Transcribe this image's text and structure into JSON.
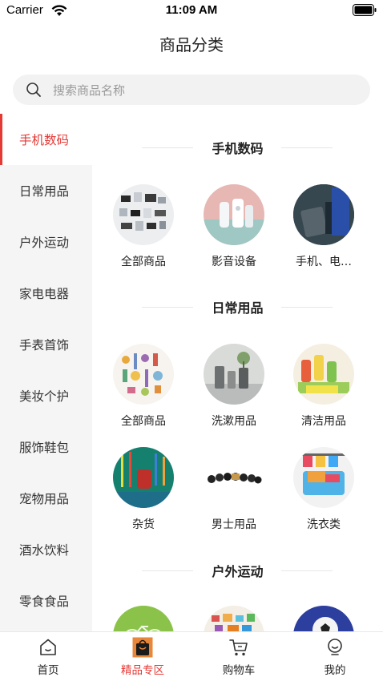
{
  "status": {
    "carrier": "Carrier",
    "time": "11:09 AM"
  },
  "nav": {
    "title": "商品分类"
  },
  "search": {
    "placeholder": "搜索商品名称"
  },
  "sidebar": {
    "items": [
      {
        "label": "手机数码",
        "active": true
      },
      {
        "label": "日常用品"
      },
      {
        "label": "户外运动"
      },
      {
        "label": "家电电器"
      },
      {
        "label": "手表首饰"
      },
      {
        "label": "美妆个护"
      },
      {
        "label": "服饰鞋包"
      },
      {
        "label": "宠物用品"
      },
      {
        "label": "酒水饮料"
      },
      {
        "label": "零食食品"
      }
    ]
  },
  "sections": [
    {
      "title": "手机数码",
      "items": [
        {
          "label": "全部商品"
        },
        {
          "label": "影音设备"
        },
        {
          "label": "手机、电…"
        }
      ]
    },
    {
      "title": "日常用品",
      "items": [
        {
          "label": "全部商品"
        },
        {
          "label": "洗漱用品"
        },
        {
          "label": "清洁用品"
        },
        {
          "label": "杂货"
        },
        {
          "label": "男士用品"
        },
        {
          "label": "洗衣类"
        }
      ]
    },
    {
      "title": "户外运动",
      "items": [
        {
          "label": ""
        },
        {
          "label": ""
        },
        {
          "label": ""
        }
      ]
    }
  ],
  "tabbar": {
    "items": [
      {
        "label": "首页",
        "icon": "home-icon"
      },
      {
        "label": "精品专区",
        "icon": "shopping-bag-icon",
        "active": true
      },
      {
        "label": "购物车",
        "icon": "cart-icon"
      },
      {
        "label": "我的",
        "icon": "profile-icon"
      }
    ]
  },
  "colors": {
    "accent": "#e53935",
    "sidebar_bg": "#f5f5f5",
    "search_bg": "#f2f2f2"
  }
}
